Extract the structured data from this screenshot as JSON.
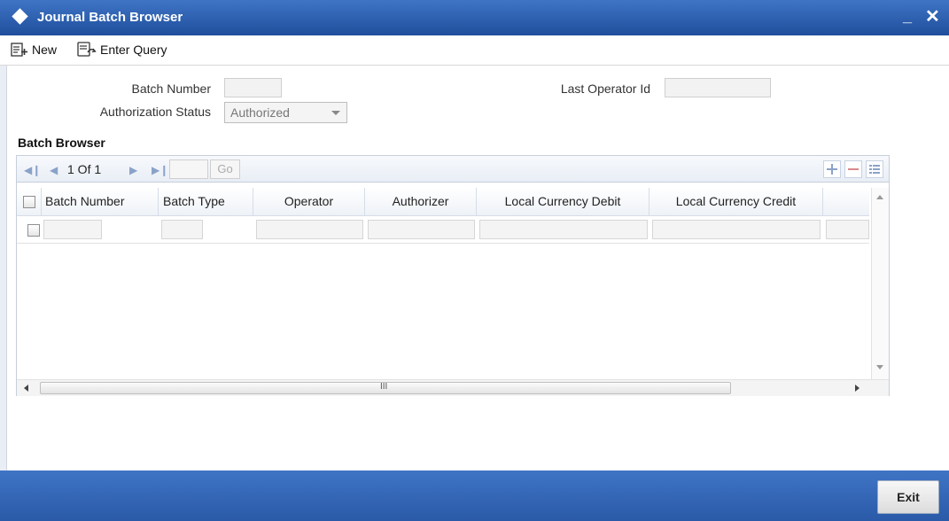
{
  "window": {
    "title": "Journal Batch Browser",
    "minimize_glyph": "_",
    "close_glyph": "✕"
  },
  "toolbar": {
    "new_label": "New",
    "enter_query_label": "Enter Query"
  },
  "form": {
    "batch_number": {
      "label": "Batch Number",
      "value": ""
    },
    "authorization_status": {
      "label": "Authorization Status",
      "selected": "Authorized"
    },
    "last_operator_id": {
      "label": "Last Operator Id",
      "value": ""
    }
  },
  "batch_browser": {
    "title": "Batch Browser",
    "pager": {
      "text": "1 Of 1",
      "go_label": "Go",
      "page_input": ""
    },
    "columns": [
      "Batch Number",
      "Batch Type",
      "Operator",
      "Authorizer",
      "Local Currency Debit",
      "Local Currency Credit"
    ],
    "scroll_grip": "III"
  },
  "footer": {
    "exit_label": "Exit"
  },
  "colors": {
    "title_bar": "#2b5fae",
    "footer": "#2f62b0",
    "grid_border": "#c6cfdb"
  },
  "icons": [
    "diamond-icon",
    "minimize-icon",
    "close-icon",
    "new-doc-icon",
    "query-icon",
    "first-page-icon",
    "prev-page-icon",
    "next-page-icon",
    "last-page-icon",
    "add-row-icon",
    "delete-row-icon",
    "single-view-icon"
  ]
}
